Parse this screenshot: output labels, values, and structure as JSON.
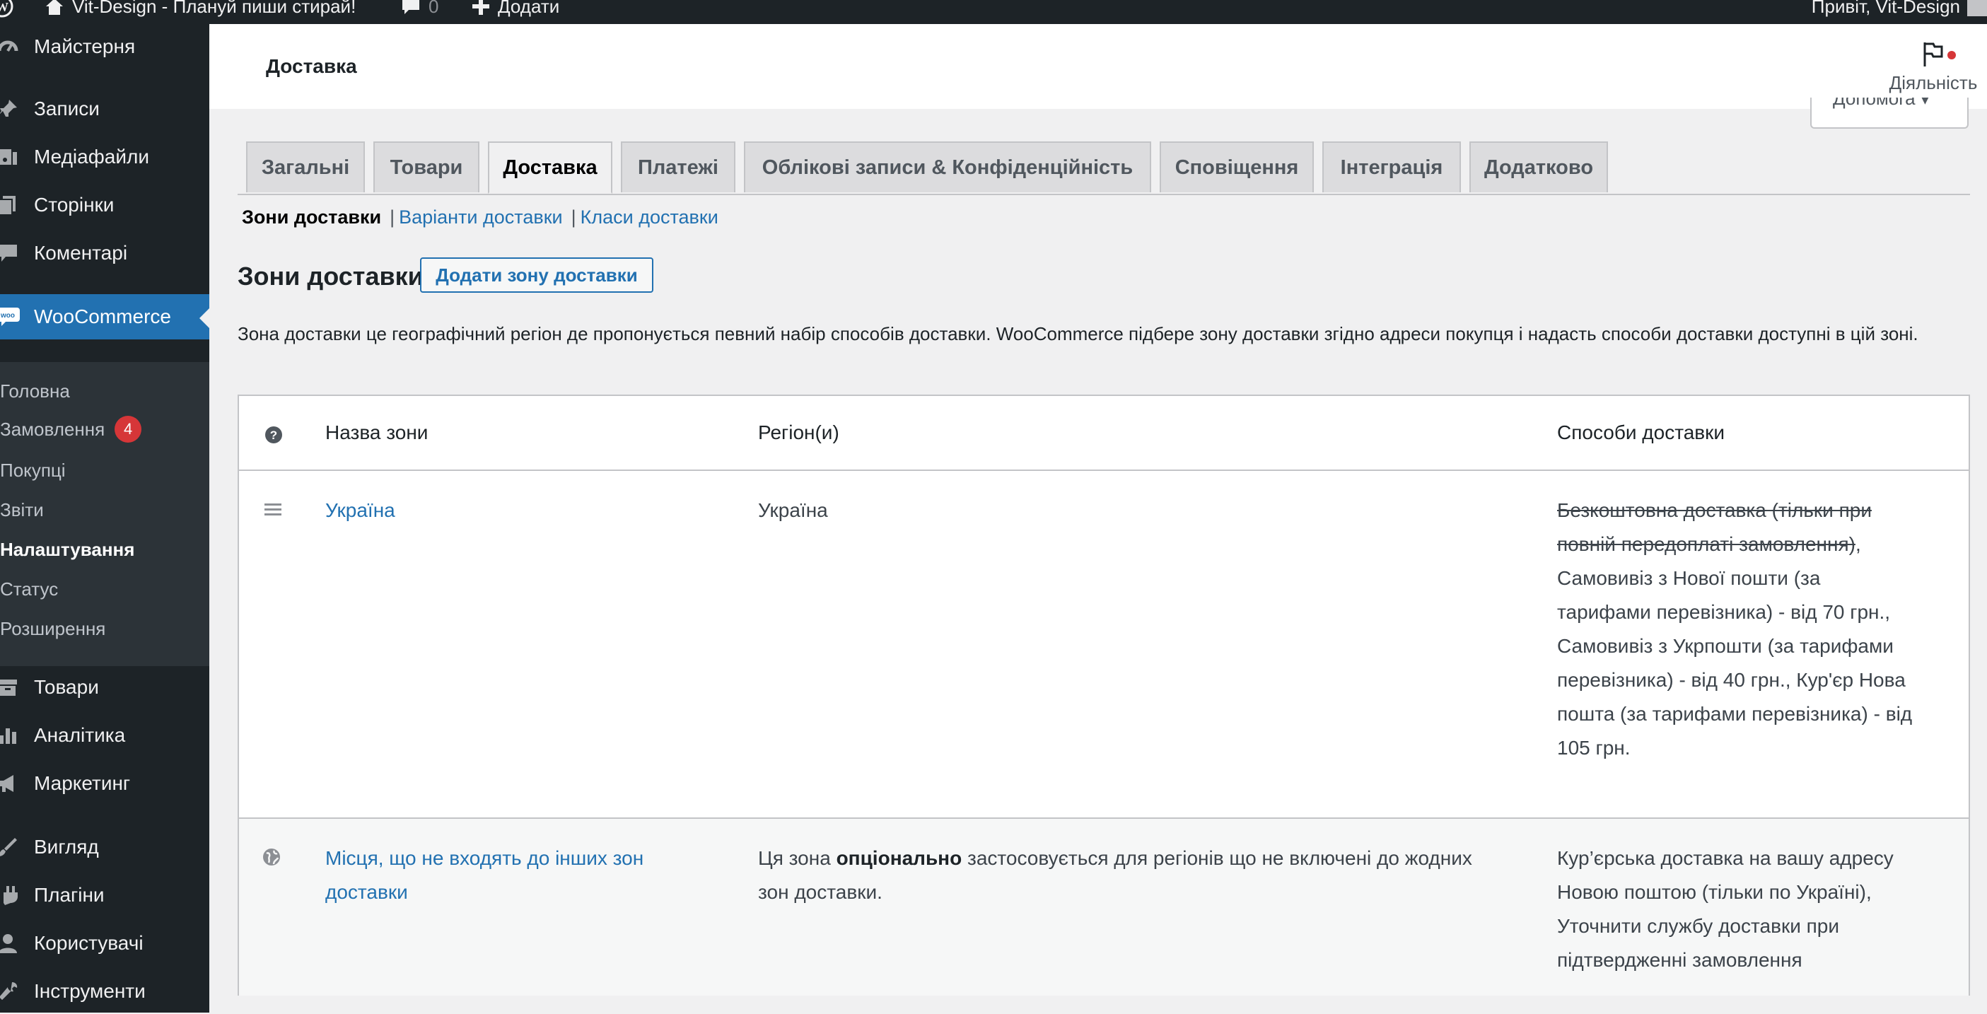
{
  "admin_bar": {
    "site_name": "Vit-Design - Плануй пиши стирай!",
    "comments_count": "0",
    "new_label": "Додати",
    "greeting": "Привіт, Vit-Design"
  },
  "sidebar": {
    "items": [
      {
        "label": "Майстерня",
        "icon": "dashboard-icon"
      },
      {
        "label": "Записи",
        "icon": "pin-icon"
      },
      {
        "label": "Медіафайли",
        "icon": "media-icon"
      },
      {
        "label": "Сторінки",
        "icon": "page-icon"
      },
      {
        "label": "Коментарі",
        "icon": "comment-icon"
      },
      {
        "label": "WooCommerce",
        "icon": "woo-icon"
      },
      {
        "label": "Товари",
        "icon": "archive-icon"
      },
      {
        "label": "Аналітика",
        "icon": "chart-icon"
      },
      {
        "label": "Маркетинг",
        "icon": "megaphone-icon"
      },
      {
        "label": "Вигляд",
        "icon": "brush-icon"
      },
      {
        "label": "Плагіни",
        "icon": "plug-icon"
      },
      {
        "label": "Користувачі",
        "icon": "user-icon"
      },
      {
        "label": "Інструменти",
        "icon": "wrench-icon"
      }
    ],
    "woo_submenu": [
      {
        "label": "Головна"
      },
      {
        "label": "Замовлення",
        "badge": "4"
      },
      {
        "label": "Покупці"
      },
      {
        "label": "Звіти"
      },
      {
        "label": "Налаштування"
      },
      {
        "label": "Статус"
      },
      {
        "label": "Розширення"
      }
    ]
  },
  "header": {
    "title": "Доставка",
    "activity_label": "Діяльність",
    "help_label": "Допомога ▾"
  },
  "tabs": [
    "Загальні",
    "Товари",
    "Доставка",
    "Платежі",
    "Облікові записи & Конфіденційність",
    "Сповіщення",
    "Інтеграція",
    "Додатково"
  ],
  "subsub": {
    "current": "Зони доставки",
    "links": [
      "Варіанти доставки",
      "Класи доставки"
    ],
    "separator": "|"
  },
  "page": {
    "heading": "Зони доставки",
    "add_button": "Додати зону доставки",
    "description": "Зона доставки це географічний регіон де пропонується певний набір способів доставки. WooCommerce підбере зону доставки згідно адреси покупця і надасть способи доставки доступні в цій зоні."
  },
  "table": {
    "headers": [
      "Назва зони",
      "Регіон(и)",
      "Способи доставки"
    ],
    "rows": [
      {
        "zone": "Україна",
        "region": "Україна",
        "methods_disabled": "Безкоштовна доставка (тільки при повній передоплаті замовлення)",
        "methods": ", Самовивіз з Нової пошти (за тарифами перевізника) - від 70 грн., Самовивіз з Укрпошти (за тарифами перевізника) - від 40 грн., Кур'єр Нова пошта (за тарифами перевізника) - від 105 грн."
      },
      {
        "zone": "Місця, що не входять до інших зон доставки",
        "region_pre": "Ця зона ",
        "region_bold": "опціонально",
        "region_post": " застосовується для регіонів що не включені до жодних зон доставки.",
        "methods": "Кур’єрська доставка на вашу адресу Новою поштою (тільки по Україні), Уточнити службу доставки при підтвердженні замовлення"
      }
    ]
  }
}
